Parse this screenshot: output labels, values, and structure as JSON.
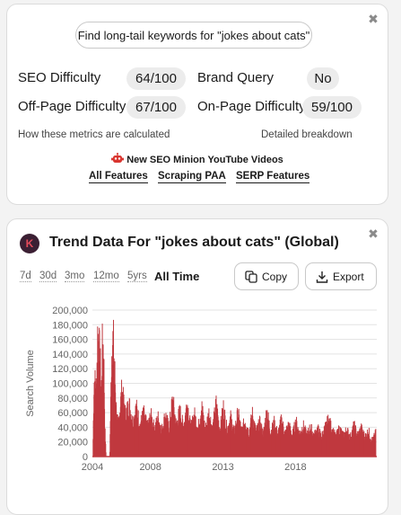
{
  "seo_card": {
    "keyword_button": "Find long-tail keywords for \"jokes about cats\"",
    "metrics": [
      {
        "label": "SEO Difficulty",
        "value": "64/100"
      },
      {
        "label": "Brand Query",
        "value": "No"
      },
      {
        "label": "Off-Page Difficulty",
        "value": "67/100"
      },
      {
        "label": "On-Page Difficulty",
        "value": "59/100"
      }
    ],
    "how_calculated": "How these metrics are calculated",
    "detailed_breakdown": "Detailed breakdown",
    "promo": "New SEO Minion YouTube Videos",
    "features": [
      "All Features",
      "Scraping PAA",
      "SERP Features"
    ],
    "close": "✖"
  },
  "trend_card": {
    "logo_letter": "K",
    "title": "Trend Data For \"jokes about cats\" (Global)",
    "ranges": [
      "7d",
      "30d",
      "3mo",
      "12mo",
      "5yrs",
      "All Time"
    ],
    "active_range": "All Time",
    "copy_label": "Copy",
    "export_label": "Export",
    "close": "✖"
  },
  "chart_data": {
    "type": "bar",
    "title": "",
    "xlabel": "",
    "ylabel": "Search Volume",
    "ylim": [
      0,
      200000
    ],
    "yticks": [
      0,
      20000,
      40000,
      60000,
      80000,
      100000,
      120000,
      140000,
      160000,
      180000,
      200000
    ],
    "ytick_labels": [
      "0",
      "20,000",
      "40,000",
      "60,000",
      "80,000",
      "100,000",
      "120,000",
      "140,000",
      "160,000",
      "180,000",
      "200,000"
    ],
    "xticks": [
      "2004",
      "2008",
      "2013",
      "2018"
    ],
    "x_start_year": 2004,
    "x_end_year": 2023,
    "color": "#c0393f",
    "grid": true,
    "series": [
      {
        "points": [
          {
            "date": "2004-01",
            "value": 0
          },
          {
            "date": "2004-02",
            "value": 110000
          },
          {
            "date": "2004-03",
            "value": 105000
          },
          {
            "date": "2004-04",
            "value": 98000
          },
          {
            "date": "2004-05",
            "value": 180000
          },
          {
            "date": "2004-06",
            "value": 160000
          },
          {
            "date": "2004-07",
            "value": 140000
          },
          {
            "date": "2004-08",
            "value": 90000
          },
          {
            "date": "2004-09",
            "value": 168000
          },
          {
            "date": "2004-10",
            "value": 150000
          },
          {
            "date": "2004-11",
            "value": 40000
          },
          {
            "date": "2004-12",
            "value": 0
          },
          {
            "date": "2005-03",
            "value": 0
          },
          {
            "date": "2005-04",
            "value": 100000
          },
          {
            "date": "2005-05",
            "value": 170000
          },
          {
            "date": "2005-06",
            "value": 165000
          },
          {
            "date": "2005-07",
            "value": 130000
          },
          {
            "date": "2005-08",
            "value": 80000
          },
          {
            "date": "2005-09",
            "value": 55000
          },
          {
            "date": "2005-10",
            "value": 45000
          },
          {
            "date": "2006-01",
            "value": 95000
          },
          {
            "date": "2006-04",
            "value": 60000
          },
          {
            "date": "2006-07",
            "value": 75000
          },
          {
            "date": "2006-10",
            "value": 50000
          },
          {
            "date": "2007-01",
            "value": 70000
          },
          {
            "date": "2007-04",
            "value": 45000
          },
          {
            "date": "2007-07",
            "value": 62000
          },
          {
            "date": "2007-10",
            "value": 42000
          },
          {
            "date": "2008-01",
            "value": 58000
          },
          {
            "date": "2008-04",
            "value": 40000
          },
          {
            "date": "2008-07",
            "value": 55000
          },
          {
            "date": "2008-10",
            "value": 38000
          },
          {
            "date": "2009-01",
            "value": 60000
          },
          {
            "date": "2009-04",
            "value": 40000
          },
          {
            "date": "2009-07",
            "value": 82000
          },
          {
            "date": "2009-10",
            "value": 45000
          },
          {
            "date": "2010-01",
            "value": 65000
          },
          {
            "date": "2010-04",
            "value": 42000
          },
          {
            "date": "2010-07",
            "value": 78000
          },
          {
            "date": "2010-10",
            "value": 40000
          },
          {
            "date": "2011-01",
            "value": 60000
          },
          {
            "date": "2011-04",
            "value": 40000
          },
          {
            "date": "2011-07",
            "value": 72000
          },
          {
            "date": "2011-10",
            "value": 38000
          },
          {
            "date": "2012-01",
            "value": 62000
          },
          {
            "date": "2012-04",
            "value": 40000
          },
          {
            "date": "2012-07",
            "value": 75000
          },
          {
            "date": "2012-10",
            "value": 38000
          },
          {
            "date": "2013-01",
            "value": 70000
          },
          {
            "date": "2013-04",
            "value": 38000
          },
          {
            "date": "2013-07",
            "value": 55000
          },
          {
            "date": "2013-10",
            "value": 35000
          },
          {
            "date": "2014-01",
            "value": 62000
          },
          {
            "date": "2014-04",
            "value": 36000
          },
          {
            "date": "2014-07",
            "value": 52000
          },
          {
            "date": "2014-10",
            "value": 34000
          },
          {
            "date": "2015-01",
            "value": 60000
          },
          {
            "date": "2015-04",
            "value": 35000
          },
          {
            "date": "2015-07",
            "value": 48000
          },
          {
            "date": "2015-10",
            "value": 32000
          },
          {
            "date": "2016-01",
            "value": 66000
          },
          {
            "date": "2016-04",
            "value": 34000
          },
          {
            "date": "2016-07",
            "value": 48000
          },
          {
            "date": "2016-10",
            "value": 32000
          },
          {
            "date": "2017-01",
            "value": 52000
          },
          {
            "date": "2017-04",
            "value": 33000
          },
          {
            "date": "2017-07",
            "value": 45000
          },
          {
            "date": "2017-10",
            "value": 30000
          },
          {
            "date": "2018-01",
            "value": 50000
          },
          {
            "date": "2018-04",
            "value": 32000
          },
          {
            "date": "2018-07",
            "value": 44000
          },
          {
            "date": "2018-10",
            "value": 30000
          },
          {
            "date": "2019-01",
            "value": 42000
          },
          {
            "date": "2019-04",
            "value": 30000
          },
          {
            "date": "2019-07",
            "value": 40000
          },
          {
            "date": "2019-10",
            "value": 28000
          },
          {
            "date": "2020-01",
            "value": 40000
          },
          {
            "date": "2020-04",
            "value": 52000
          },
          {
            "date": "2020-07",
            "value": 38000
          },
          {
            "date": "2020-10",
            "value": 28000
          },
          {
            "date": "2021-01",
            "value": 40000
          },
          {
            "date": "2021-04",
            "value": 30000
          },
          {
            "date": "2021-07",
            "value": 38000
          },
          {
            "date": "2021-10",
            "value": 28000
          },
          {
            "date": "2022-01",
            "value": 44000
          },
          {
            "date": "2022-04",
            "value": 30000
          },
          {
            "date": "2022-07",
            "value": 40000
          },
          {
            "date": "2022-10",
            "value": 28000
          },
          {
            "date": "2023-01",
            "value": 36000
          },
          {
            "date": "2023-04",
            "value": 22000
          },
          {
            "date": "2023-07",
            "value": 33000
          }
        ]
      }
    ]
  }
}
